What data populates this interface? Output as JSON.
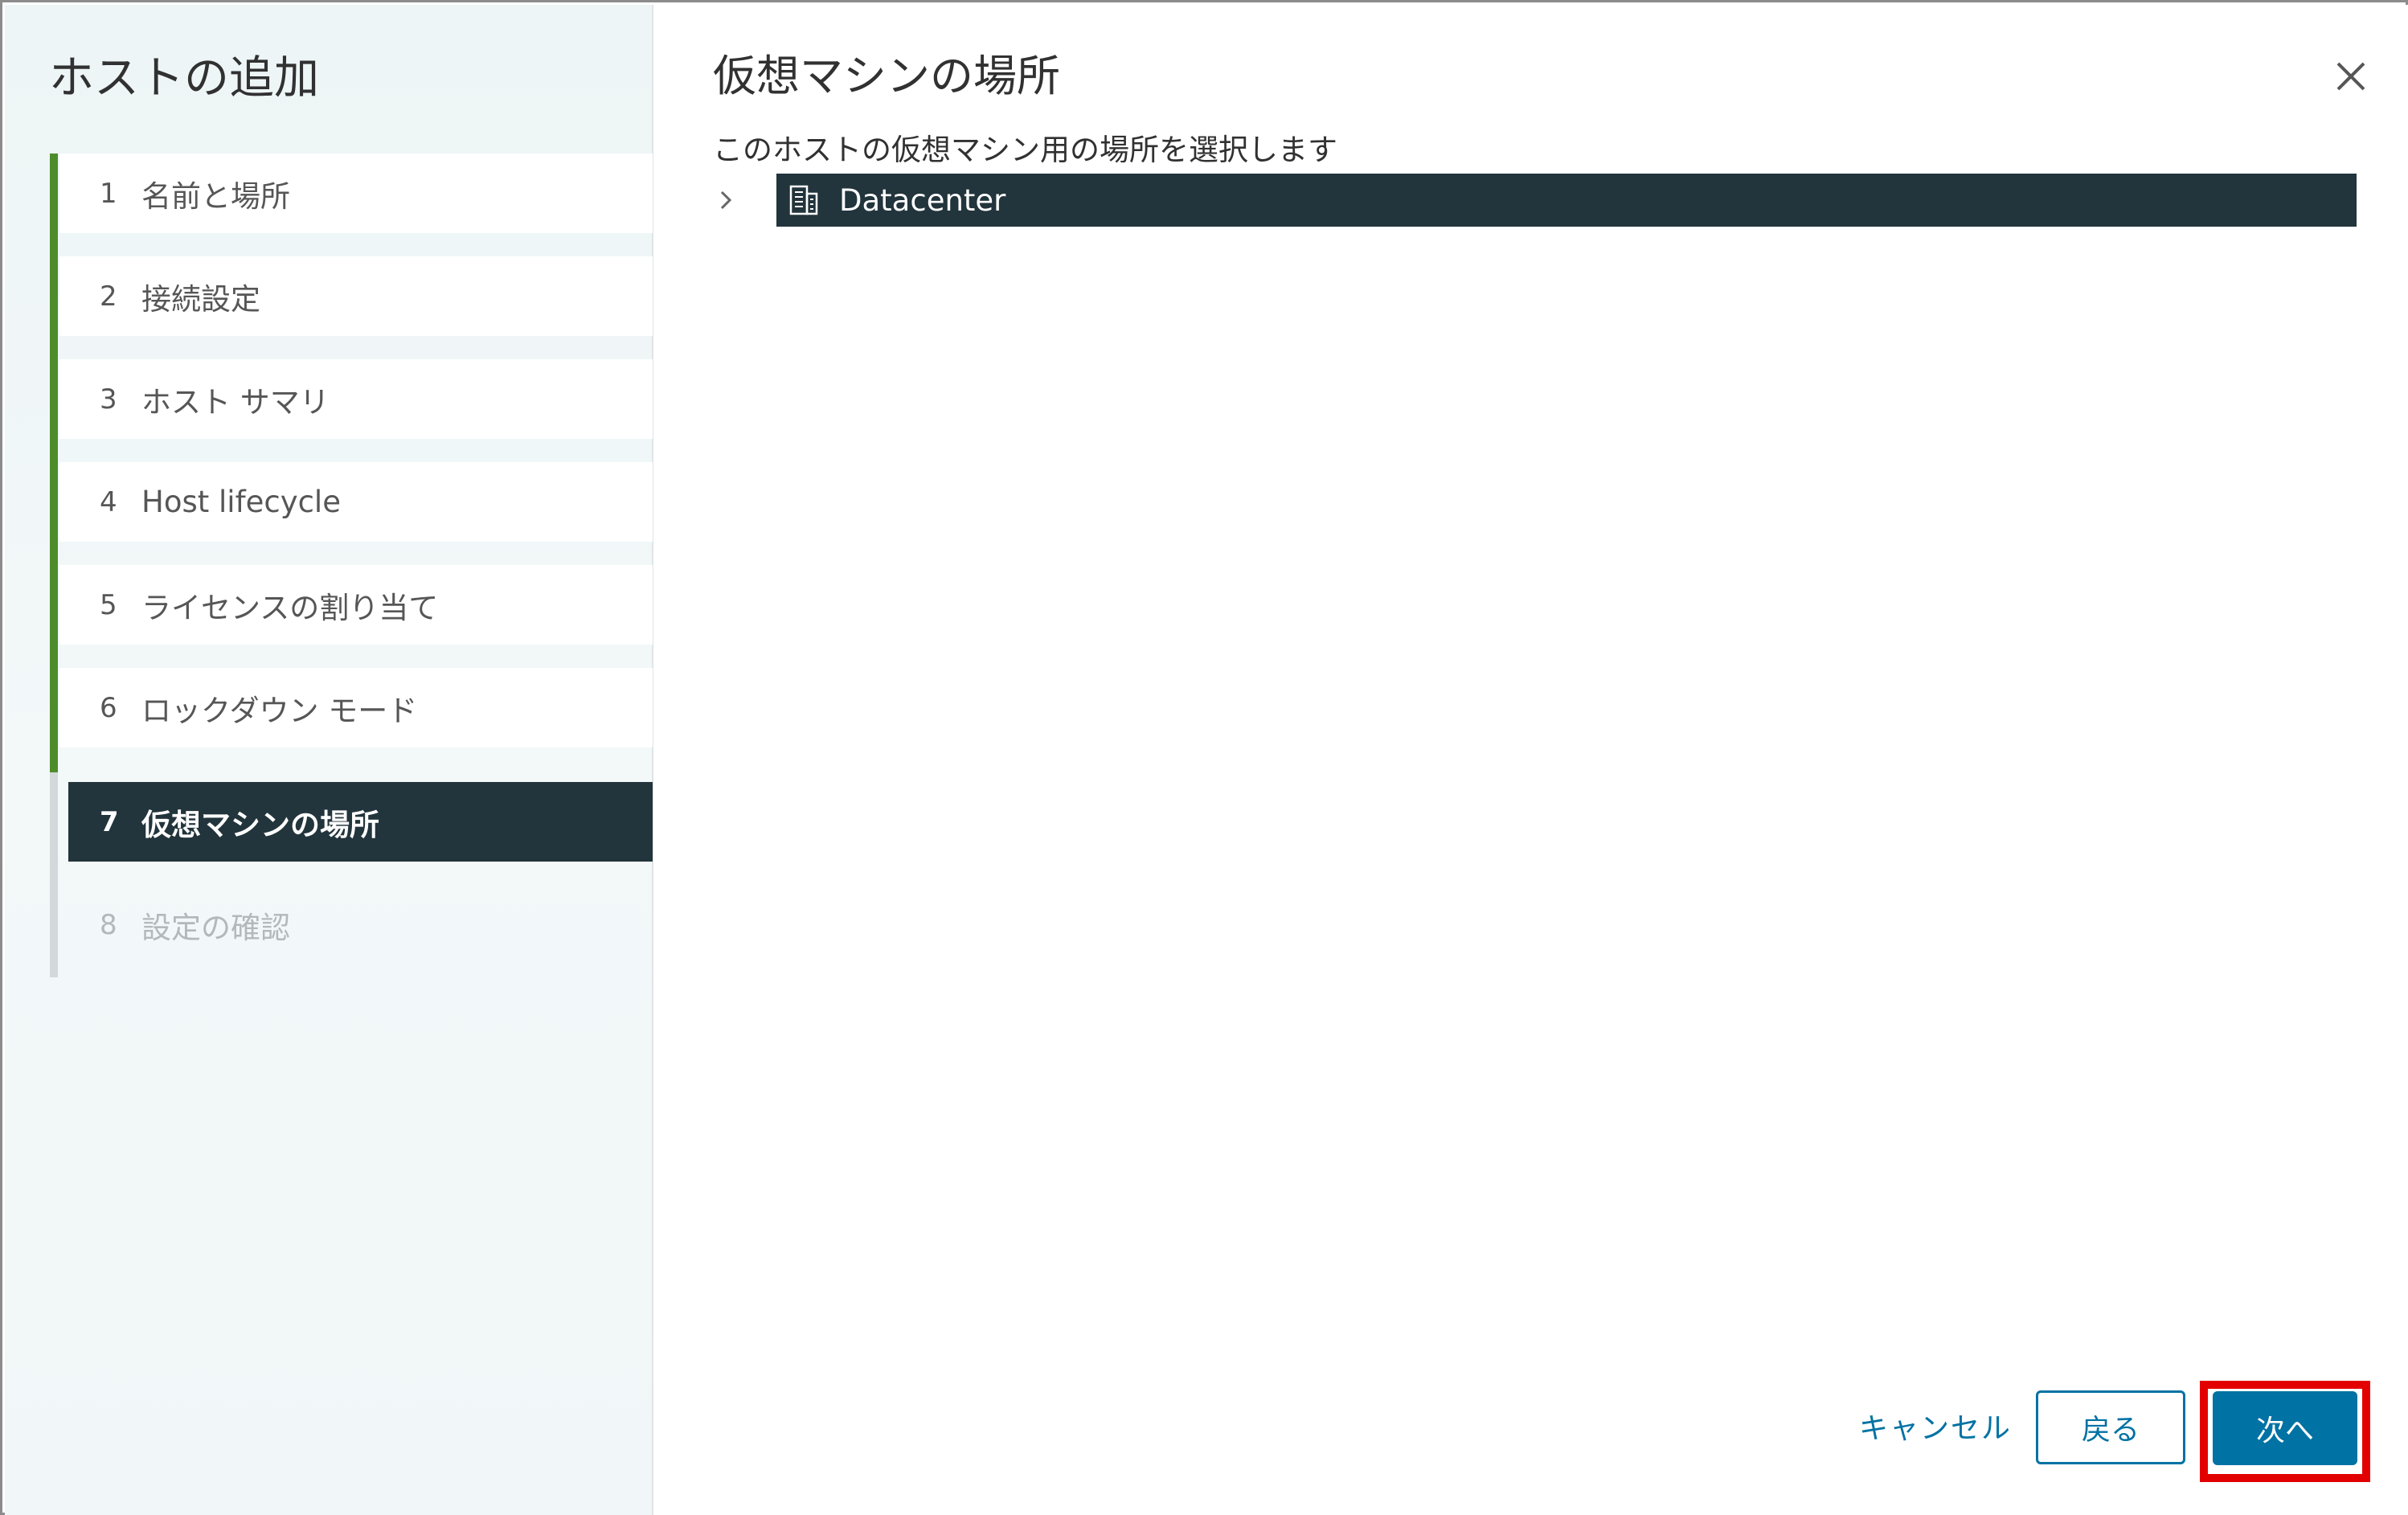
{
  "sidebar": {
    "title": "ホストの追加",
    "steps": [
      {
        "num": "1",
        "label": "名前と場所",
        "state": "completed"
      },
      {
        "num": "2",
        "label": "接続設定",
        "state": "completed"
      },
      {
        "num": "3",
        "label": "ホスト サマリ",
        "state": "completed"
      },
      {
        "num": "4",
        "label": "Host lifecycle",
        "state": "completed"
      },
      {
        "num": "5",
        "label": "ライセンスの割り当て",
        "state": "completed"
      },
      {
        "num": "6",
        "label": "ロックダウン モード",
        "state": "completed"
      },
      {
        "num": "7",
        "label": "仮想マシンの場所",
        "state": "active"
      },
      {
        "num": "8",
        "label": "設定の確認",
        "state": "disabled"
      }
    ]
  },
  "main": {
    "title": "仮想マシンの場所",
    "subtitle": "このホストの仮想マシン用の場所を選択します",
    "tree": {
      "node_label": "Datacenter",
      "node_icon": "datacenter-icon",
      "expander_icon": "chevron-right-icon",
      "selected": true
    }
  },
  "footer": {
    "cancel_label": "キャンセル",
    "back_label": "戻る",
    "next_label": "次へ"
  },
  "colors": {
    "accent": "#0072a3",
    "selected_bg": "#22343c",
    "progress_done": "#4e8c2b",
    "highlight": "#e30000"
  }
}
